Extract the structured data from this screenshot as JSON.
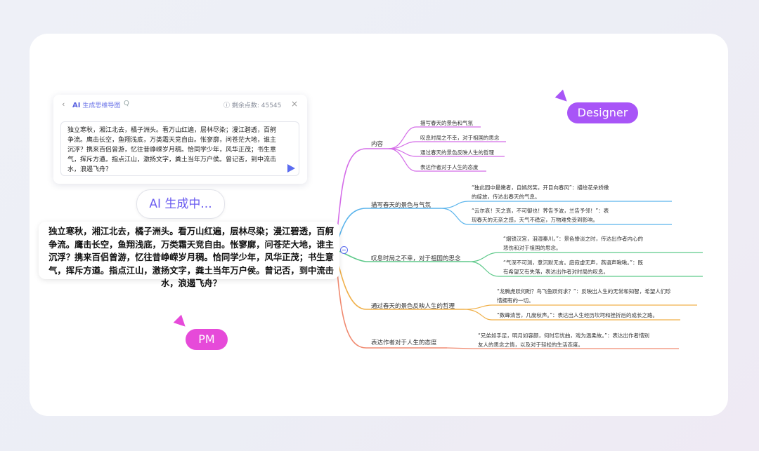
{
  "ai_panel": {
    "back_icon": "‹",
    "title_ai": "AI",
    "title_rest": " 生成思维导图",
    "search_icon": "Q",
    "points_label": "ⓘ 剩余点数: 45545",
    "close_icon": "×",
    "input_text": "独立寒秋，湘江北去，橘子洲头。看万山红遍，层林尽染；漫江碧透，百舸争流。鹰击长空，鱼翔浅底，万类霜天竞自由。怅寥廓，问苍茫大地，谁主沉浮？携来百侣曾游，忆往昔峥嵘岁月稠。恰同学少年，风华正茂；书生意气，挥斥方遒。指点江山，激扬文字，粪土当年万户侯。曾记否，到中流击水，浪遏飞舟？"
  },
  "status": {
    "generating": "AI 生成中..."
  },
  "poem": {
    "text": "独立寒秋，湘江北去，橘子洲头。看万山红遍，层林尽染；漫江碧透，百舸争流。鹰击长空，鱼翔浅底，万类霜天竞自由。怅寥廓，问苍茫大地，谁主沉浮？携来百侣曾游，忆往昔峥嵘岁月稠。恰同学少年，风华正茂；书生意气，挥斥方遒。指点江山，激扬文字，粪土当年万户侯。曾记否，到中流击水，浪遏飞舟？"
  },
  "collaborators": {
    "designer": "Designer",
    "pm": "PM"
  },
  "mindmap": {
    "branches": [
      {
        "label": "内容",
        "color": "#d46ce8",
        "children": [
          "描写春天的景色和气氛",
          "叹息时局之不幸，对于祖国的思念",
          "通过春天的景色反映人生的哲理",
          "表达作者对于人生的态度"
        ]
      },
      {
        "label": "描写春天的景色与气氛",
        "color": "#5ab4ec",
        "children": [
          "“独此园中最嫩者，自嫣然笑，开目向春风”：描绘花朵娇嫩的绽放，传达出春天的气息。",
          "“云尔哀！天之衰，不可御也！荠告予波，兰告予邻！”：表现春天的无奈之感，天气不稳定，万物难免受到影响。"
        ]
      },
      {
        "label": "叹息时局之不幸，对于祖国的思念",
        "color": "#5ec98a",
        "children": [
          "“烟锁汉宫，泪湿秦川。”：景色惨淡之时，传达出作者内心的悲伤和对于祖国的思念。",
          "“气深不可测，意沉默无言。庭寂虚无声，燕语声啾啾。”：既有希望又有失落，表达出作者对时局的叹息。"
        ]
      },
      {
        "label": "通过春天的景色反映人生的哲理",
        "color": "#f0b04a",
        "children": [
          "“龙腾虎跃何盼？鸟飞鱼跃何求？”：反映出人生的无常和知智，希望人们珍惜拥有的一切。",
          "“数峰清苦，几度秋声。”：表达出人生经历坎坷和挫折后的成长之路。"
        ]
      },
      {
        "label": "表达作者对于人生的态度",
        "color": "#f08a70",
        "children": [
          "“兄弟如手足，明月如容颜，何时忘忧曲，戏为温柔故。”：表达出作者惜别友人的思念之情，以及对于轻松的生活态度。"
        ]
      }
    ]
  }
}
